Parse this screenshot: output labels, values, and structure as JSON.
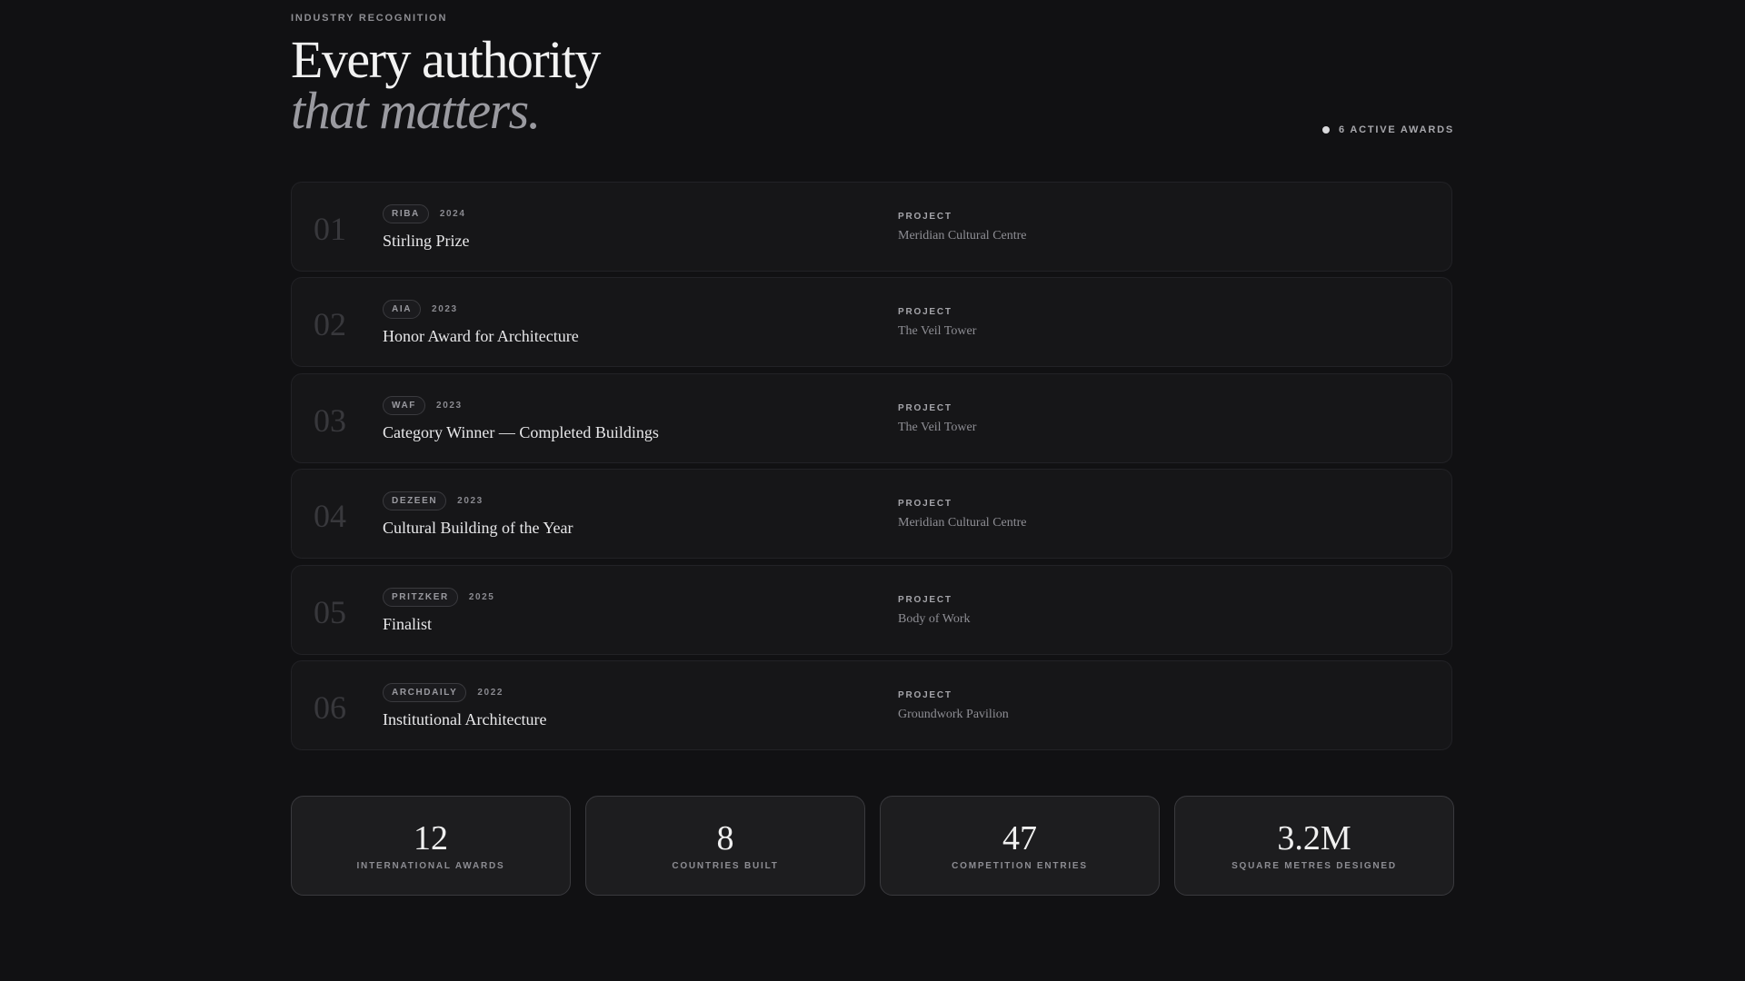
{
  "header": {
    "eyebrow": "INDUSTRY RECOGNITION",
    "headline_line1": "Every authority",
    "headline_line2": "that matters.",
    "active_count": "6 ACTIVE AWARDS"
  },
  "awards": {
    "project_label": "PROJECT",
    "items": [
      {
        "num": "01",
        "org": "RIBA",
        "year": "2024",
        "title": "Stirling Prize",
        "project": "Meridian Cultural Centre"
      },
      {
        "num": "02",
        "org": "AIA",
        "year": "2023",
        "title": "Honor Award for Architecture",
        "project": "The Veil Tower"
      },
      {
        "num": "03",
        "org": "WAF",
        "year": "2023",
        "title": "Category Winner — Completed Buildings",
        "project": "The Veil Tower"
      },
      {
        "num": "04",
        "org": "DEZEEN",
        "year": "2023",
        "title": "Cultural Building of the Year",
        "project": "Meridian Cultural Centre"
      },
      {
        "num": "05",
        "org": "PRITZKER",
        "year": "2025",
        "title": "Finalist",
        "project": "Body of Work"
      },
      {
        "num": "06",
        "org": "ARCHDAILY",
        "year": "2022",
        "title": "Institutional Architecture",
        "project": "Groundwork Pavilion"
      }
    ]
  },
  "stats": [
    {
      "value": "12",
      "label": "INTERNATIONAL AWARDS"
    },
    {
      "value": "8",
      "label": "COUNTRIES BUILT"
    },
    {
      "value": "47",
      "label": "COMPETITION ENTRIES"
    },
    {
      "value": "3.2M",
      "label": "SQUARE METRES DESIGNED"
    }
  ],
  "colors": {
    "background": "#111113",
    "card": "#161618",
    "text": "#e8e8e8",
    "muted": "#8d8d92"
  }
}
